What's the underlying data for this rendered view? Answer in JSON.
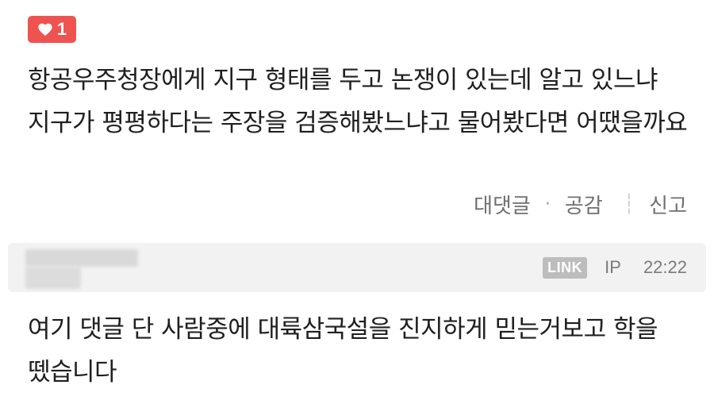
{
  "like_badge": {
    "icon": "heart-icon",
    "count": "1",
    "color": "#ef5350"
  },
  "comment": {
    "text": "항공우주청장에게 지구 형태를 두고 논쟁이 있는데 알고 있느냐 지구가 평평하다는 주장을 검증해봤느냐고 물어봤다면 어땠을까요"
  },
  "actions": {
    "reply_label": "대댓글",
    "separator": "·",
    "like_label": "공감",
    "report_label": "신고"
  },
  "reply": {
    "link_badge": "LINK",
    "ip_label": "IP",
    "time": "22:22",
    "text": "여기 댓글 단 사람중에 대륙삼국설을 진지하게 믿는거보고 학을 뗐습니다"
  }
}
